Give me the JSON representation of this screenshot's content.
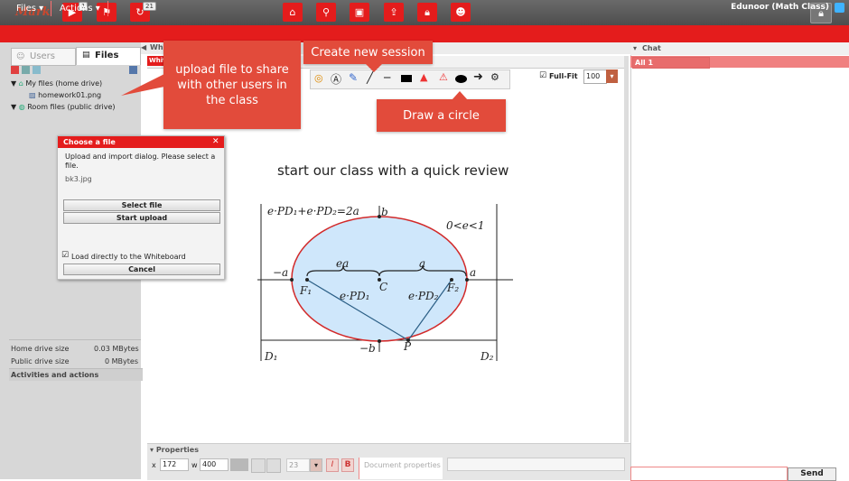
{
  "app": {
    "brand": "Mark"
  },
  "topbar": {
    "video_badge": "1",
    "session_badge": "21"
  },
  "menubar": {
    "files_label": "Files",
    "actions_label": "Actions",
    "user_info": "Edunoor (Math Class)"
  },
  "left": {
    "tab_users": "Users",
    "tab_files": "Files",
    "tree": {
      "my_files": "My files (home drive)",
      "homework_file": "homework01.png",
      "room_files": "Room files (public drive)"
    },
    "stats": [
      {
        "label": "Home drive size",
        "value": "0.03 MBytes"
      },
      {
        "label": "Public drive size",
        "value": "0 MBytes"
      }
    ],
    "activities_header": "Activities and actions"
  },
  "main": {
    "header": "Whiteboard",
    "tab_label": "Whiteb",
    "fullfit_label": "Full-Fit",
    "zoom_value": "100"
  },
  "whiteboard": {
    "title": "start our class with a quick review",
    "formula_top": "e·PD₁+e·PD₂=2a",
    "constraint": "0<e<1",
    "label_b": "b",
    "label_neg_b": "−b",
    "label_a": "a",
    "label_neg_a": "−a",
    "label_ea": "ea",
    "label_a2": "a",
    "label_F1": "F₁",
    "label_F2": "F₂",
    "label_C": "C",
    "label_ePD1": "e·PD₁",
    "label_ePD2": "e·PD₂",
    "label_P": "P",
    "label_D1": "D₁",
    "label_D2": "D₂"
  },
  "tooltips": {
    "upload": "upload file to share with other users in the class",
    "session": "Create new session",
    "circle": "Draw a circle"
  },
  "dialog": {
    "title": "Choose a file",
    "message": "Upload and import dialog. Please select a file.",
    "filename": "bk3.jpg",
    "select_btn": "Select file",
    "start_btn": "Start upload",
    "checkbox_label": "Load directly to the Whiteboard",
    "cancel_btn": "Cancel"
  },
  "chat": {
    "header": "Chat",
    "selector": "All 1",
    "send": "Send"
  },
  "properties": {
    "header": "Properties",
    "x_label": "x",
    "x_value": "172",
    "w_label": "w",
    "w_value": "400",
    "font_size": "23",
    "italic": "I",
    "bold": "B",
    "doc_props_placeholder": "Document properties"
  },
  "colors": {
    "accent": "#e41c1c",
    "tooltip": "#e24b3b",
    "ellipse_fill": "#cfe7fb",
    "ellipse_stroke": "#d22a2a"
  }
}
